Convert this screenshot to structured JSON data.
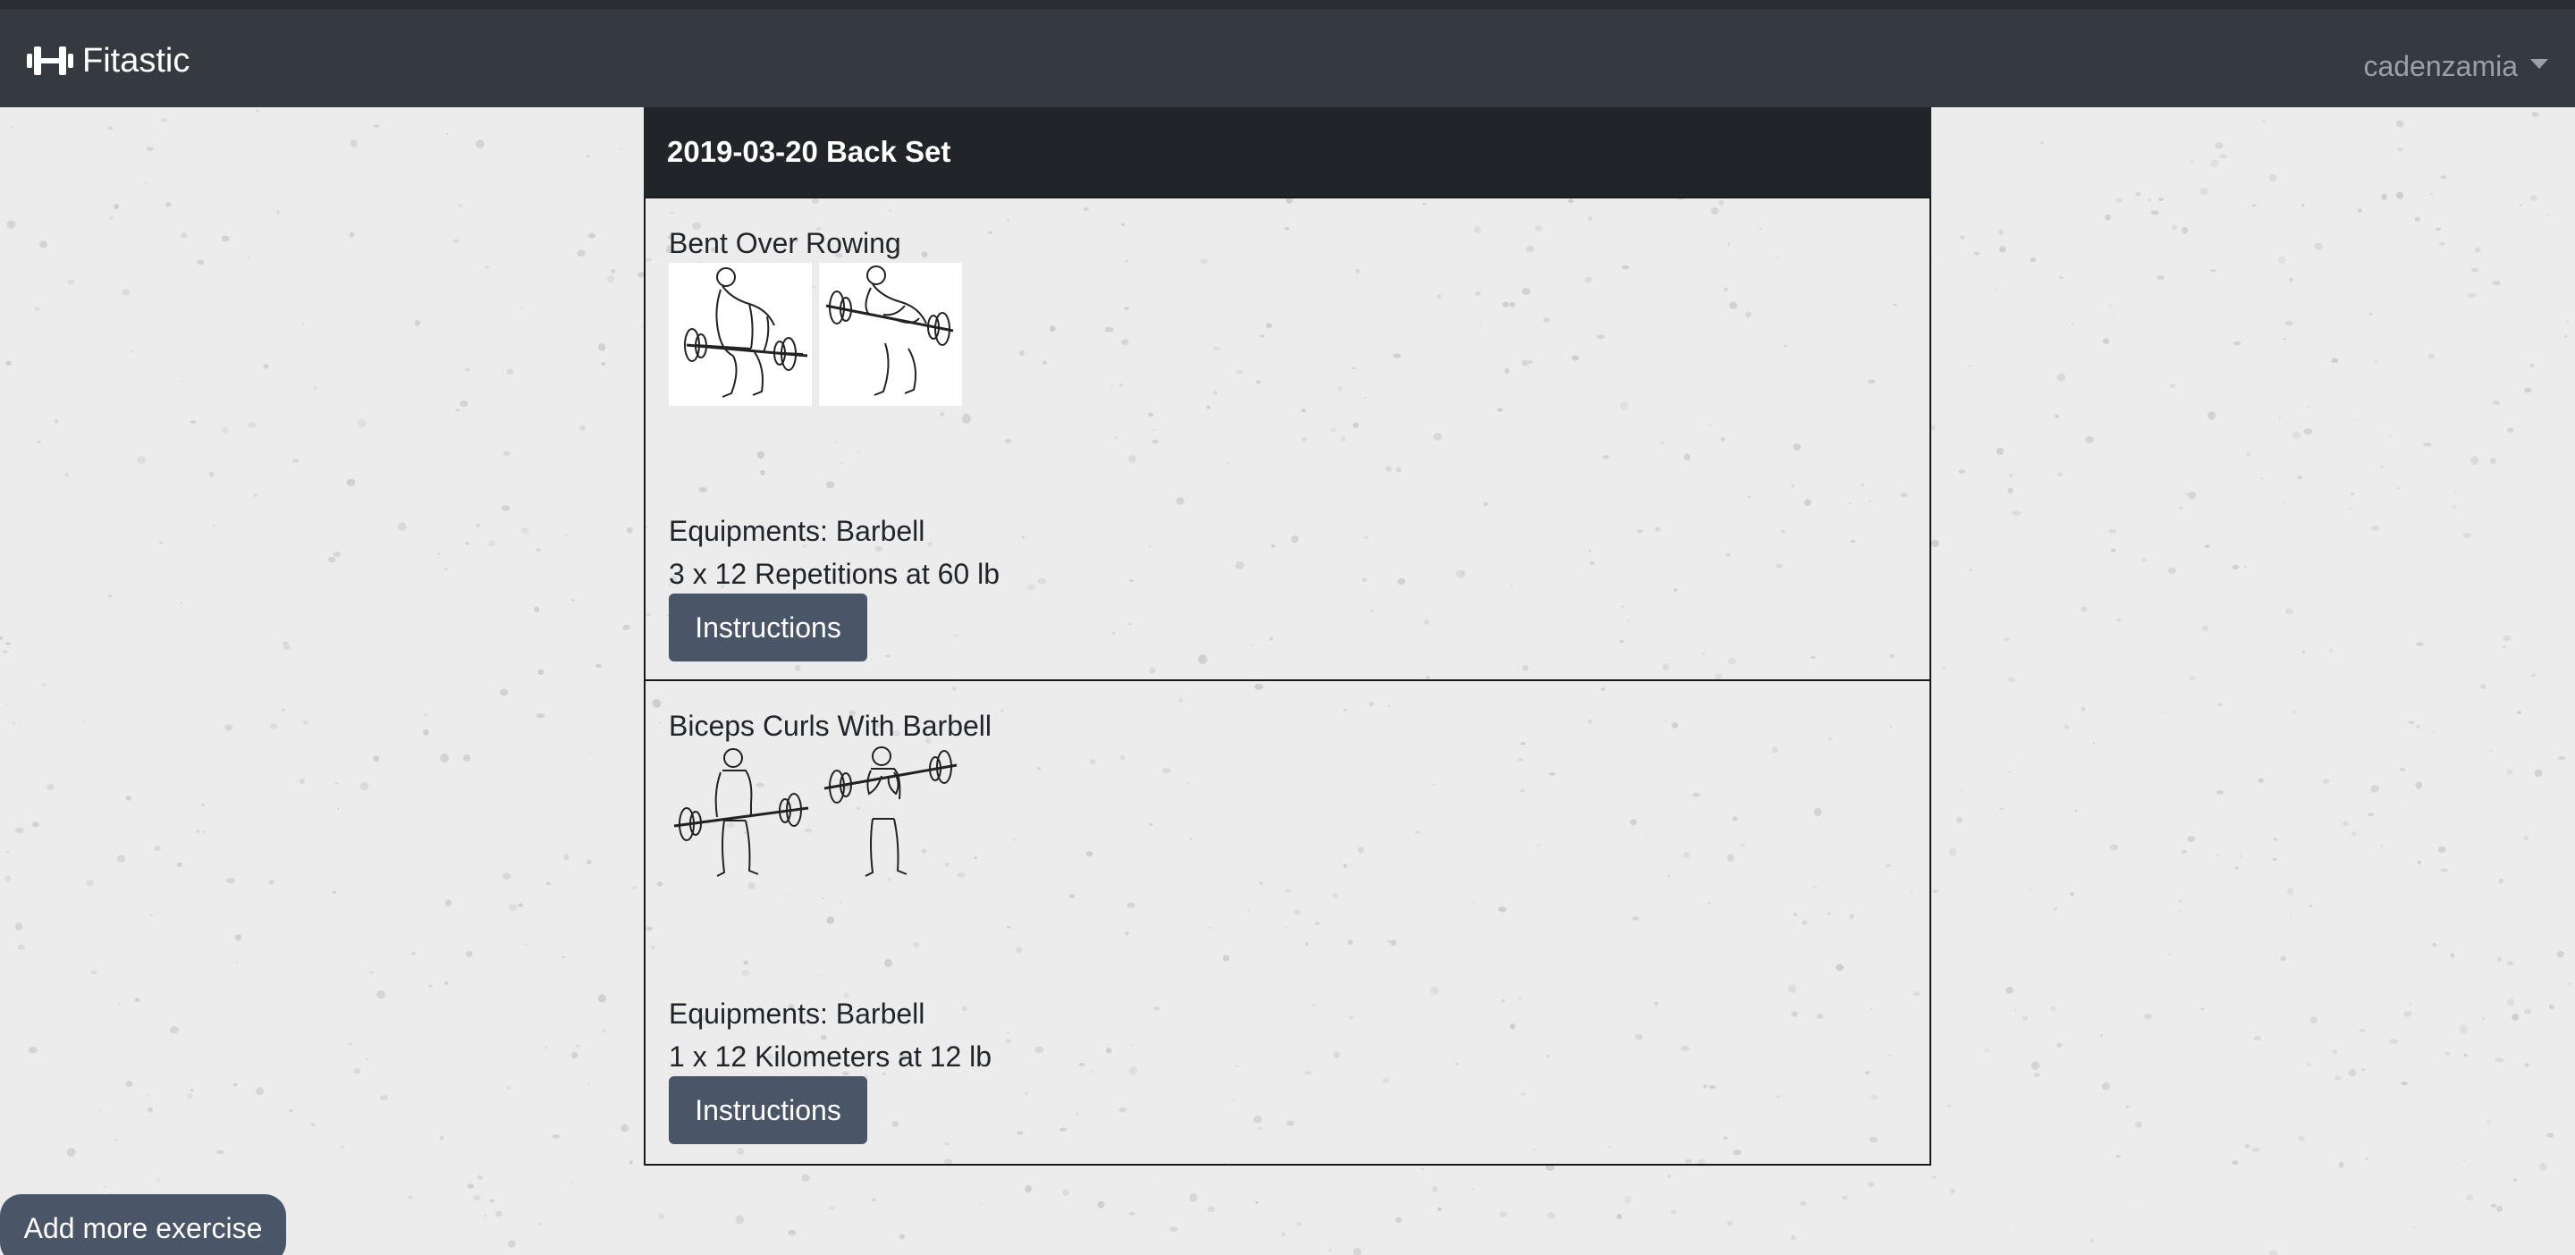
{
  "navbar": {
    "brand": "Fitastic",
    "brand_icon": "dumbbell-icon",
    "user": "cadenzamia"
  },
  "workout": {
    "title": "2019-03-20 Back Set",
    "exercises": [
      {
        "name": "Bent Over Rowing",
        "images": [
          "bent-over-row-start-image",
          "bent-over-row-end-image"
        ],
        "equipment": "Equipments: Barbell",
        "sets": "3 x 12 Repetitions at 60 lb",
        "button": "Instructions"
      },
      {
        "name": "Biceps Curls With Barbell",
        "images": [
          "barbell-curl-start-image",
          "barbell-curl-end-image"
        ],
        "equipment": "Equipments: Barbell",
        "sets": "1 x 12 Kilometers at 12 lb",
        "button": "Instructions"
      }
    ]
  },
  "actions": {
    "add_more": "Add more exercise"
  },
  "colors": {
    "navbar_bg": "#343a40",
    "card_header_bg": "#212529",
    "button_bg": "#4a5568",
    "page_bg": "#ececec"
  }
}
